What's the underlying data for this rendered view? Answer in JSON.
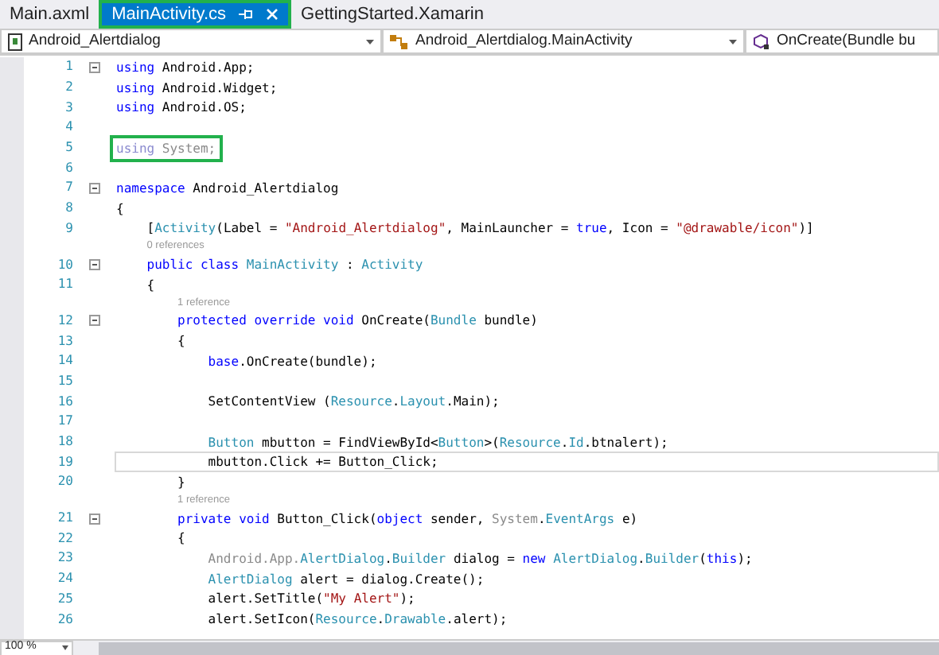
{
  "tabs": [
    {
      "label": "Main.axml",
      "selected": false,
      "highlighted": false
    },
    {
      "label": "MainActivity.cs",
      "selected": true,
      "highlighted": true
    },
    {
      "label": "GettingStarted.Xamarin",
      "selected": false,
      "highlighted": false
    }
  ],
  "navigation": [
    {
      "kind": "project",
      "label": "Android_Alertdialog"
    },
    {
      "kind": "class",
      "label": "Android_Alertdialog.MainActivity"
    },
    {
      "kind": "member",
      "label": "OnCreate(Bundle bu"
    }
  ],
  "lines": [
    {
      "number": "1",
      "collapsible": true,
      "tokens": [
        {
          "kind": "kw",
          "text": "using"
        },
        {
          "kind": "plain",
          "text": " Android.App;"
        }
      ]
    },
    {
      "number": "2",
      "collapsible": false,
      "tokens": [
        {
          "kind": "kw",
          "text": "using"
        },
        {
          "kind": "plain",
          "text": " Android.Widget;"
        }
      ]
    },
    {
      "number": "3",
      "collapsible": false,
      "tokens": [
        {
          "kind": "kw",
          "text": "using"
        },
        {
          "kind": "plain",
          "text": " Android.OS;"
        }
      ]
    },
    {
      "number": "4",
      "collapsible": false
    },
    {
      "number": "5",
      "collapsible": false,
      "highlighted": true,
      "tokens": [
        {
          "kind": "dimkw",
          "text": "using"
        },
        {
          "kind": "dim",
          "text": " System;"
        }
      ]
    },
    {
      "number": "6",
      "collapsible": false
    },
    {
      "number": "7",
      "collapsible": true,
      "tokens": [
        {
          "kind": "kw",
          "text": "namespace"
        },
        {
          "kind": "plain",
          "text": " Android_Alertdialog"
        }
      ]
    },
    {
      "number": "8",
      "collapsible": false,
      "tokens": [
        {
          "kind": "plain",
          "text": "{"
        }
      ]
    },
    {
      "number": "9",
      "collapsible": false,
      "tokens": [
        {
          "kind": "plain",
          "text": "    ["
        },
        {
          "kind": "type",
          "text": "Activity"
        },
        {
          "kind": "plain",
          "text": "(Label = "
        },
        {
          "kind": "str",
          "text": "\"Android_Alertdialog\""
        },
        {
          "kind": "plain",
          "text": ", MainLauncher = "
        },
        {
          "kind": "kw",
          "text": "true"
        },
        {
          "kind": "plain",
          "text": ", Icon = "
        },
        {
          "kind": "str",
          "text": "\"@drawable/icon\""
        },
        {
          "kind": "plain",
          "text": ")]"
        }
      ]
    },
    {
      "number": "10",
      "collapsible": true,
      "codelens": "0 references",
      "tokens": [
        {
          "kind": "kw",
          "text": "    public class"
        },
        {
          "kind": "type",
          "text": " MainActivity"
        },
        {
          "kind": "plain",
          "text": " : "
        },
        {
          "kind": "type",
          "text": "Activity"
        }
      ]
    },
    {
      "number": "11",
      "collapsible": false,
      "tokens": [
        {
          "kind": "plain",
          "text": "    {"
        }
      ]
    },
    {
      "number": "12",
      "collapsible": true,
      "codelens": "1 reference",
      "tokens": [
        {
          "kind": "kw",
          "text": "        protected override void"
        },
        {
          "kind": "plain",
          "text": " OnCreate("
        },
        {
          "kind": "type",
          "text": "Bundle"
        },
        {
          "kind": "plain",
          "text": " bundle)"
        }
      ]
    },
    {
      "number": "13",
      "collapsible": false,
      "tokens": [
        {
          "kind": "plain",
          "text": "        {"
        }
      ]
    },
    {
      "number": "14",
      "collapsible": false,
      "tokens": [
        {
          "kind": "kw",
          "text": "            base"
        },
        {
          "kind": "plain",
          "text": ".OnCreate(bundle);"
        }
      ]
    },
    {
      "number": "15",
      "collapsible": false
    },
    {
      "number": "16",
      "collapsible": false,
      "tokens": [
        {
          "kind": "plain",
          "text": "            SetContentView ("
        },
        {
          "kind": "type",
          "text": "Resource"
        },
        {
          "kind": "plain",
          "text": "."
        },
        {
          "kind": "type",
          "text": "Layout"
        },
        {
          "kind": "plain",
          "text": ".Main);"
        }
      ]
    },
    {
      "number": "17",
      "collapsible": false
    },
    {
      "number": "18",
      "collapsible": false,
      "tokens": [
        {
          "kind": "type",
          "text": "            Button"
        },
        {
          "kind": "plain",
          "text": " mbutton = FindViewById<"
        },
        {
          "kind": "type",
          "text": "Button"
        },
        {
          "kind": "plain",
          "text": ">("
        },
        {
          "kind": "type",
          "text": "Resource"
        },
        {
          "kind": "plain",
          "text": "."
        },
        {
          "kind": "type",
          "text": "Id"
        },
        {
          "kind": "plain",
          "text": ".btnalert);"
        }
      ]
    },
    {
      "number": "19",
      "collapsible": false,
      "current": true,
      "tokens": [
        {
          "kind": "plain",
          "text": "            mbutton.Click += Button_Click;"
        }
      ]
    },
    {
      "number": "20",
      "collapsible": false,
      "tokens": [
        {
          "kind": "plain",
          "text": "        }"
        }
      ]
    },
    {
      "number": "21",
      "collapsible": true,
      "codelens": "1 reference",
      "tokens": [
        {
          "kind": "kw",
          "text": "        private void"
        },
        {
          "kind": "plain",
          "text": " Button_Click("
        },
        {
          "kind": "kw",
          "text": "object"
        },
        {
          "kind": "plain",
          "text": " sender, "
        },
        {
          "kind": "dim",
          "text": "System"
        },
        {
          "kind": "plain",
          "text": "."
        },
        {
          "kind": "type",
          "text": "EventArgs"
        },
        {
          "kind": "plain",
          "text": " e)"
        }
      ]
    },
    {
      "number": "22",
      "collapsible": false,
      "tokens": [
        {
          "kind": "plain",
          "text": "        {"
        }
      ]
    },
    {
      "number": "23",
      "collapsible": false,
      "tokens": [
        {
          "kind": "dim",
          "text": "            Android.App."
        },
        {
          "kind": "type",
          "text": "AlertDialog"
        },
        {
          "kind": "plain",
          "text": "."
        },
        {
          "kind": "type",
          "text": "Builder"
        },
        {
          "kind": "plain",
          "text": " dialog = "
        },
        {
          "kind": "kw",
          "text": "new"
        },
        {
          "kind": "type",
          "text": " AlertDialog"
        },
        {
          "kind": "plain",
          "text": "."
        },
        {
          "kind": "type",
          "text": "Builder"
        },
        {
          "kind": "plain",
          "text": "("
        },
        {
          "kind": "kw",
          "text": "this"
        },
        {
          "kind": "plain",
          "text": ");"
        }
      ]
    },
    {
      "number": "24",
      "collapsible": false,
      "tokens": [
        {
          "kind": "type",
          "text": "            AlertDialog"
        },
        {
          "kind": "plain",
          "text": " alert = dialog.Create();"
        }
      ]
    },
    {
      "number": "25",
      "collapsible": false,
      "tokens": [
        {
          "kind": "plain",
          "text": "            alert.SetTitle("
        },
        {
          "kind": "str",
          "text": "\"My Alert\""
        },
        {
          "kind": "plain",
          "text": ");"
        }
      ]
    },
    {
      "number": "26",
      "collapsible": false,
      "tokens": [
        {
          "kind": "plain",
          "text": "            alert.SetIcon("
        },
        {
          "kind": "type",
          "text": "Resource"
        },
        {
          "kind": "plain",
          "text": "."
        },
        {
          "kind": "type",
          "text": "Drawable"
        },
        {
          "kind": "plain",
          "text": ".alert);"
        }
      ]
    }
  ],
  "status_bar": {
    "zoom": "100 %"
  }
}
